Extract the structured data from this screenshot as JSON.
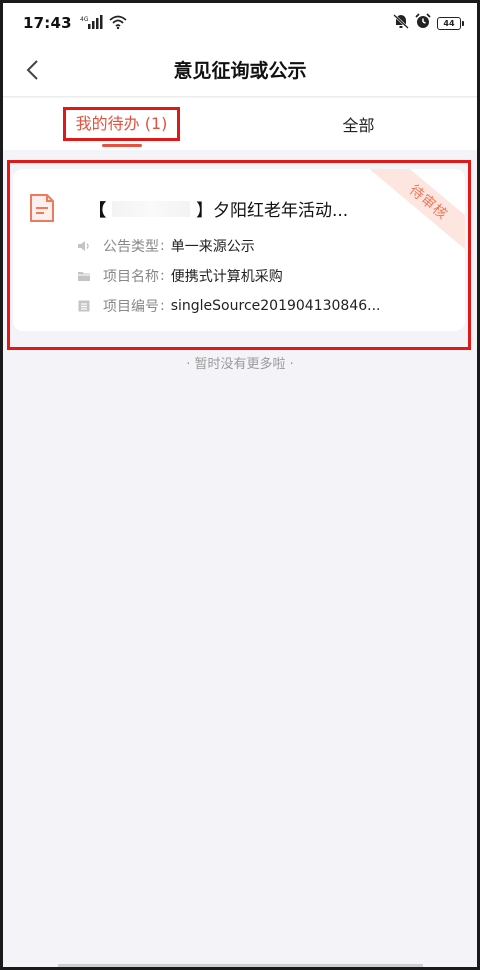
{
  "status_bar": {
    "time": "17:43",
    "network": "4G",
    "battery": "44",
    "icons": [
      "signal-icon",
      "wifi-icon",
      "mute-icon",
      "alarm-icon",
      "battery-icon"
    ]
  },
  "header": {
    "title": "意见征询或公示",
    "back_icon": "chevron-left-icon"
  },
  "tabs": [
    {
      "label": "我的待办 (1)",
      "active": true
    },
    {
      "label": "全部",
      "active": false
    }
  ],
  "card": {
    "title_prefix": "【",
    "title_suffix": "】夕阳红老年活动...",
    "status_ribbon": "待审核",
    "rows": [
      {
        "icon": "speaker-icon",
        "label": "公告类型",
        "value": "单一来源公示"
      },
      {
        "icon": "folder-icon",
        "label": "项目名称",
        "value": "便携式计算机采购"
      },
      {
        "icon": "list-icon",
        "label": "项目编号",
        "value": "singleSource201904130846..."
      }
    ]
  },
  "footer": {
    "no_more_text": "· 暂时没有更多啦 ·"
  },
  "colors": {
    "accent": "#e8513d",
    "ribbon_bg": "#fde6df",
    "ribbon_text": "#f07a5c",
    "highlight_box": "#e01818",
    "page_bg": "#f4f4f8"
  }
}
